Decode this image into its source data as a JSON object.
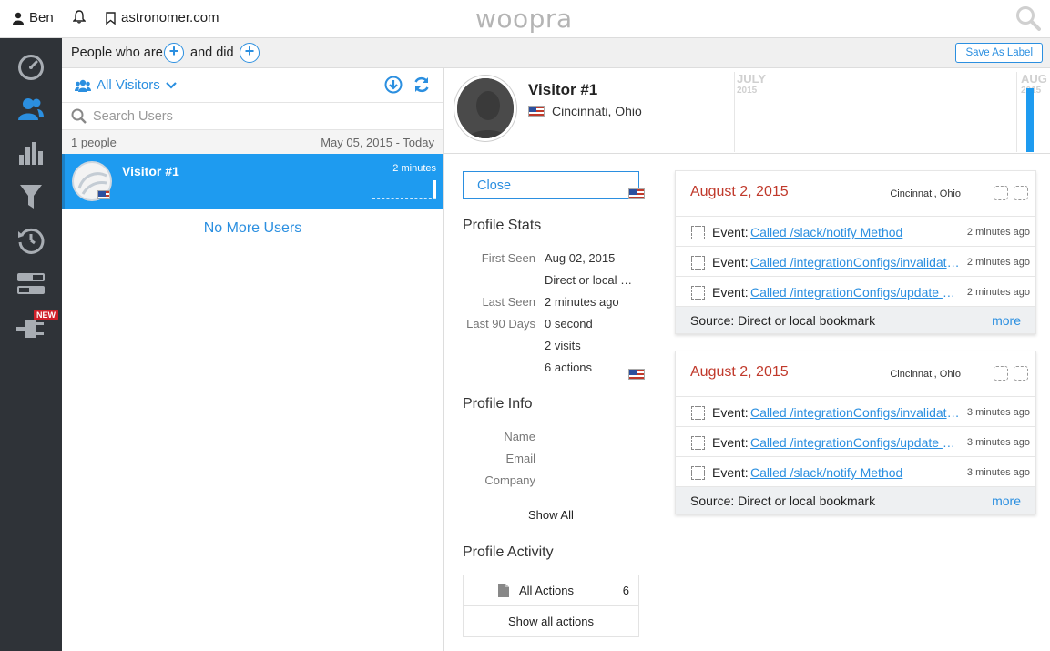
{
  "topbar": {
    "user": "Ben",
    "site": "astronomer.com",
    "logo": "woopra"
  },
  "filter": {
    "people_who_are": "People who are",
    "and_did": "and did",
    "save_label": "Save As Label"
  },
  "list": {
    "segment": "All Visitors",
    "search_placeholder": "Search Users",
    "count": "1 people",
    "date_range": "May 05, 2015 - Today",
    "visitor_name": "Visitor #1",
    "visitor_time": "2 minutes",
    "no_more": "No More Users"
  },
  "profile": {
    "name": "Visitor #1",
    "location": "Cincinnati, Ohio",
    "timeline": [
      {
        "month": "JULY",
        "year": "2015"
      },
      {
        "month": "AUG",
        "year": "2015"
      }
    ]
  },
  "stats": {
    "close": "Close",
    "profile_stats_title": "Profile Stats",
    "first_seen_label": "First Seen",
    "first_seen_value": "Aug 02, 2015",
    "first_seen_source": "Direct or local …",
    "last_seen_label": "Last Seen",
    "last_seen_value": "2 minutes ago",
    "last90_label": "Last 90 Days",
    "last90_time": "0 second",
    "last90_visits": "2 visits",
    "last90_actions": "6 actions",
    "profile_info_title": "Profile Info",
    "name_label": "Name",
    "email_label": "Email",
    "company_label": "Company",
    "show_all": "Show All",
    "profile_activity_title": "Profile Activity",
    "all_actions_label": "All Actions",
    "all_actions_count": "6",
    "show_all_actions": "Show all actions"
  },
  "visits": [
    {
      "date": "August 2, 2015",
      "location": "Cincinnati, Ohio",
      "events": [
        {
          "label": "Event:",
          "name": "Called /slack/notify Method",
          "ago": "2 minutes ago"
        },
        {
          "label": "Event:",
          "name": "Called /integrationConfigs/invalidate Method",
          "ago": "2 minutes ago"
        },
        {
          "label": "Event:",
          "name": "Called /integrationConfigs/update Method",
          "ago": "2 minutes ago"
        }
      ],
      "source": "Source: Direct or local bookmark",
      "more": "more"
    },
    {
      "date": "August 2, 2015",
      "location": "Cincinnati, Ohio",
      "events": [
        {
          "label": "Event:",
          "name": "Called /integrationConfigs/invalidate Method",
          "ago": "3 minutes ago"
        },
        {
          "label": "Event:",
          "name": "Called /integrationConfigs/update Method",
          "ago": "3 minutes ago"
        },
        {
          "label": "Event:",
          "name": "Called /slack/notify Method",
          "ago": "3 minutes ago"
        }
      ],
      "source": "Source: Direct or local bookmark",
      "more": "more"
    }
  ],
  "sidebar": {
    "new_badge": "NEW",
    "icons": [
      "dashboard-icon",
      "people-icon",
      "reports-icon",
      "funnel-icon",
      "retention-icon",
      "labels-icon",
      "integrations-icon"
    ]
  },
  "colors": {
    "accent": "#2b8fe0",
    "selected_row": "#1e9bf0",
    "sidebar": "#2f3338",
    "date_red": "#c0392b"
  }
}
